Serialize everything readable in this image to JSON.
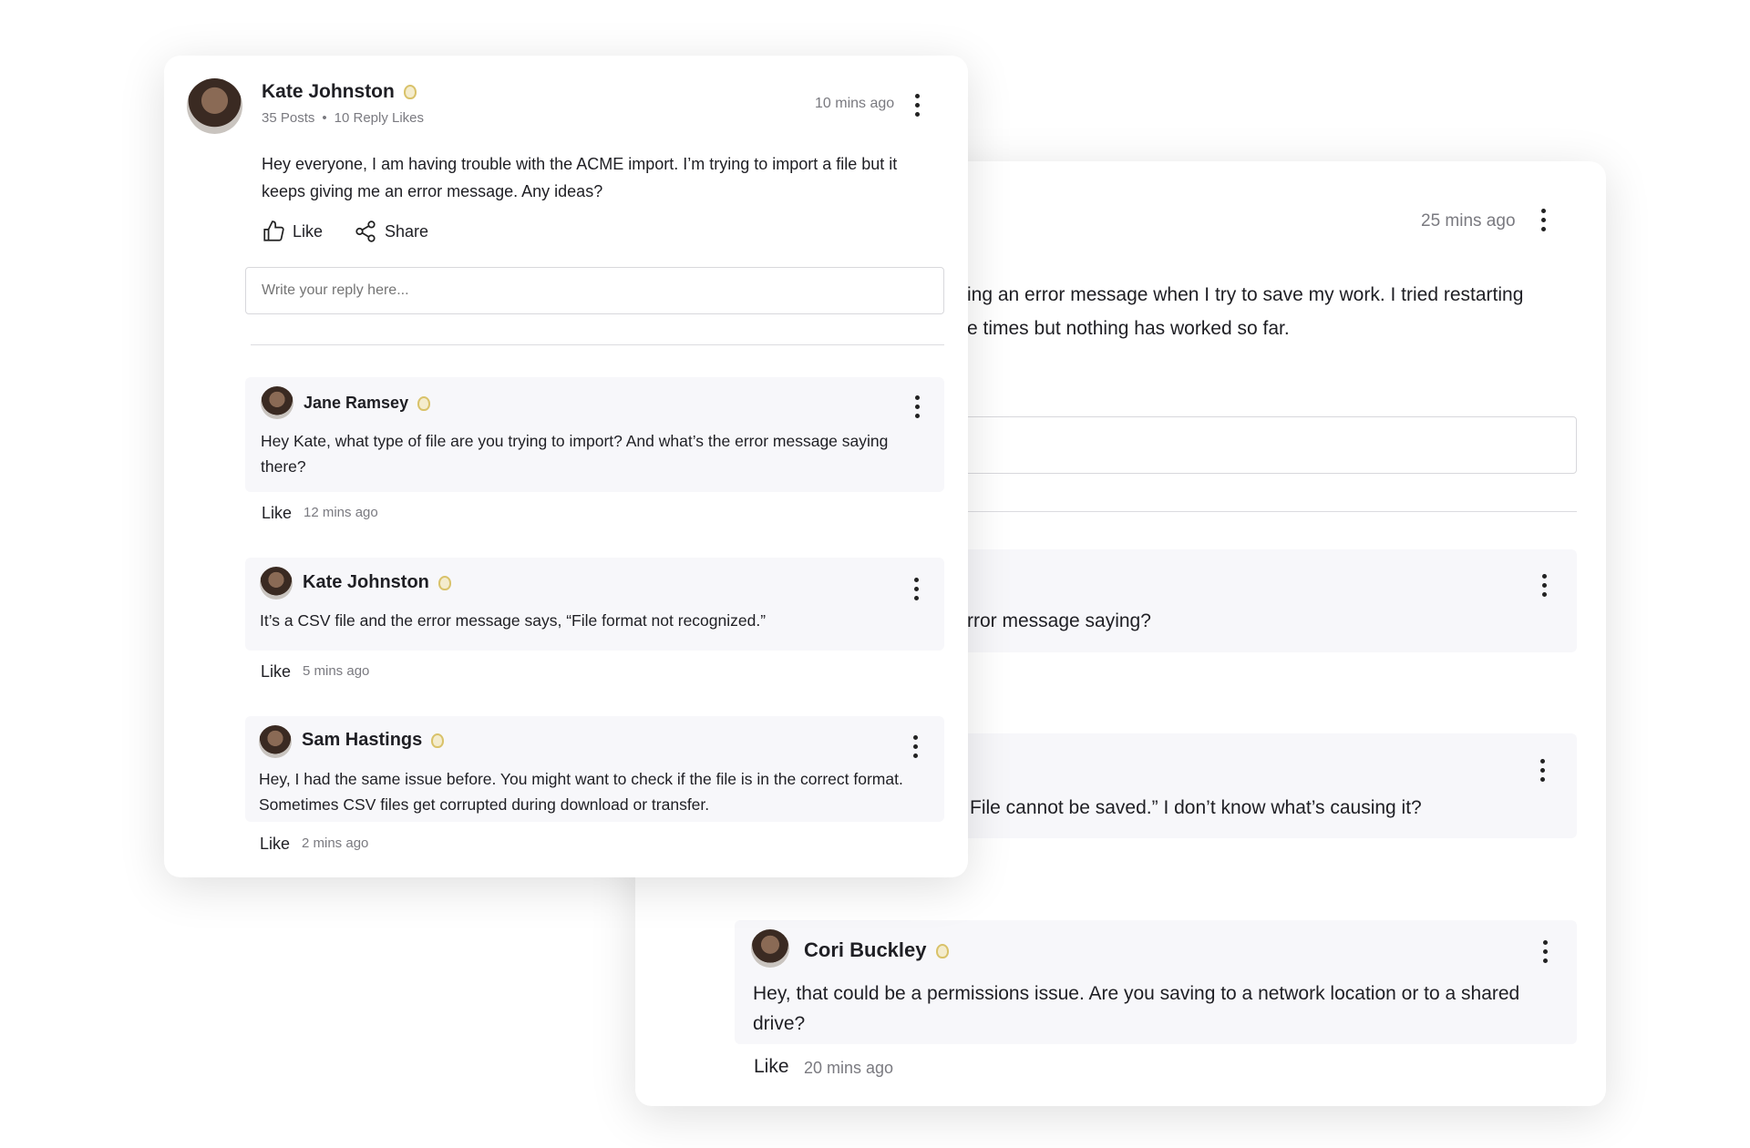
{
  "main_post": {
    "author": "Kate Johnston",
    "posts": "35 Posts",
    "reply_likes": "10 Reply Likes",
    "time": "10 mins ago",
    "body": "Hey everyone, I am having trouble with the ACME import. I’m trying to import a file but it keeps giving me an error message. Any ideas?",
    "like_label": "Like",
    "share_label": "Share",
    "reply_placeholder": "Write your reply here...",
    "replies": [
      {
        "author": "Jane Ramsey",
        "text": "Hey Kate, what type of file are you trying to import? And what’s the error message saying there?",
        "like": "Like",
        "time": "12 mins ago"
      },
      {
        "author": "Kate Johnston",
        "text": "It’s a CSV file and the error message says, “File format not recognized.”",
        "like": "Like",
        "time": "5 mins ago"
      },
      {
        "author": "Sam Hastings",
        "text": "Hey, I had the same issue before. You might want to check if the file is in the correct format. Sometimes CSV files get corrupted during download or transfer.",
        "like": "Like",
        "time": "2 mins ago"
      }
    ]
  },
  "back_post": {
    "time": "25 mins ago",
    "body_line1": "ing an error message when I try to save my work. I tried restarting",
    "body_line2": "e times but nothing has worked so far.",
    "reply_a_text": "rror message saying?",
    "reply_b_text": "File cannot be saved.” I don’t know what’s causing it?",
    "reply_c": {
      "author": "Cori Buckley",
      "text": "Hey, that could be a permissions issue. Are you saving to a network location or to a shared drive?",
      "like": "Like",
      "time": "20 mins ago"
    }
  }
}
